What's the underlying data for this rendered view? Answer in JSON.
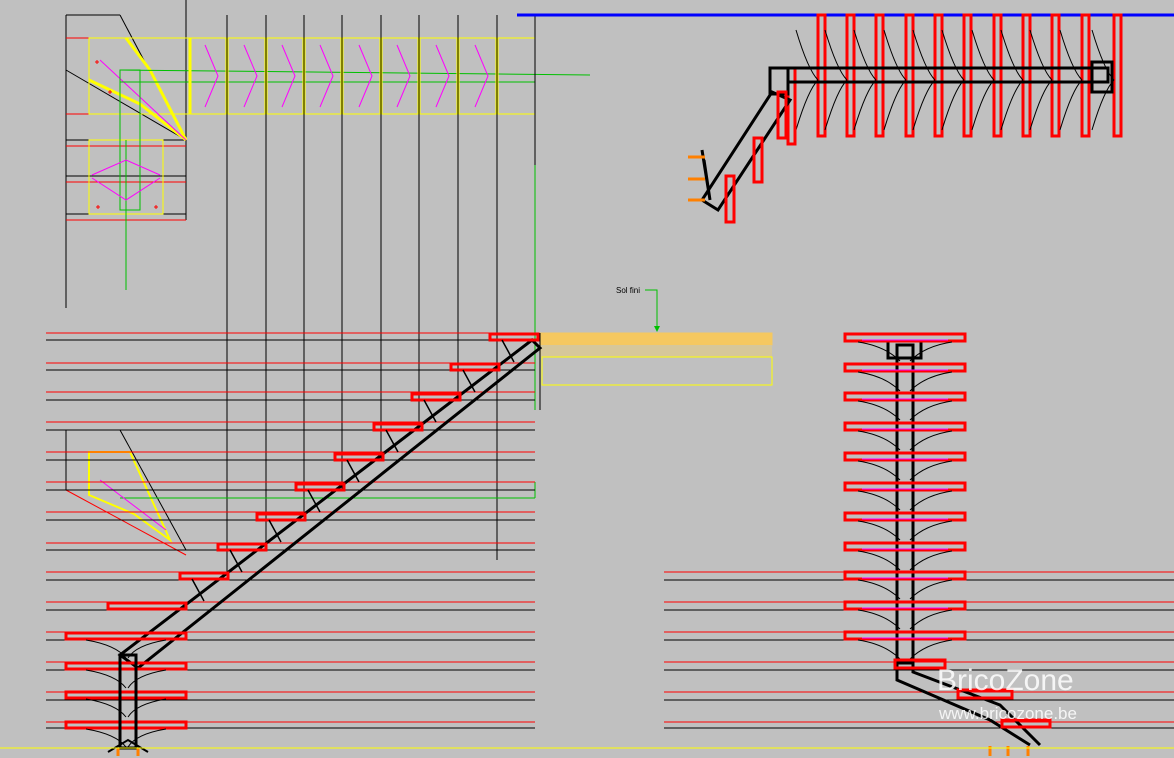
{
  "drawing": {
    "annotation_label": "Sol fini"
  },
  "watermark": {
    "title": "BricoZone",
    "url": "www.bricozone.be"
  },
  "colors": {
    "background": "#c0c0c0",
    "line_black": "#000000",
    "tread_red": "#ff0000",
    "guide_yellow": "#ffff00",
    "guide_green": "#00c000",
    "accent_magenta": "#ff00ff",
    "floor_blue": "#0000ff",
    "floor_fill": "#f5c860",
    "bolt_orange": "#ff8000"
  }
}
